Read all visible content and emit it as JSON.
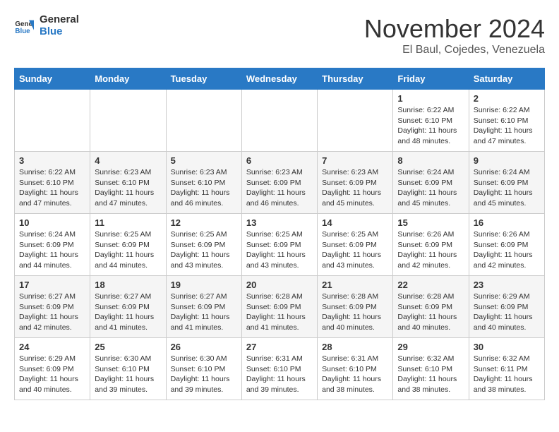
{
  "logo": {
    "line1": "General",
    "line2": "Blue"
  },
  "title": "November 2024",
  "location": "El Baul, Cojedes, Venezuela",
  "weekdays": [
    "Sunday",
    "Monday",
    "Tuesday",
    "Wednesday",
    "Thursday",
    "Friday",
    "Saturday"
  ],
  "weeks": [
    [
      {
        "day": "",
        "sunrise": "",
        "sunset": "",
        "daylight": ""
      },
      {
        "day": "",
        "sunrise": "",
        "sunset": "",
        "daylight": ""
      },
      {
        "day": "",
        "sunrise": "",
        "sunset": "",
        "daylight": ""
      },
      {
        "day": "",
        "sunrise": "",
        "sunset": "",
        "daylight": ""
      },
      {
        "day": "",
        "sunrise": "",
        "sunset": "",
        "daylight": ""
      },
      {
        "day": "1",
        "sunrise": "Sunrise: 6:22 AM",
        "sunset": "Sunset: 6:10 PM",
        "daylight": "Daylight: 11 hours and 48 minutes."
      },
      {
        "day": "2",
        "sunrise": "Sunrise: 6:22 AM",
        "sunset": "Sunset: 6:10 PM",
        "daylight": "Daylight: 11 hours and 47 minutes."
      }
    ],
    [
      {
        "day": "3",
        "sunrise": "Sunrise: 6:22 AM",
        "sunset": "Sunset: 6:10 PM",
        "daylight": "Daylight: 11 hours and 47 minutes."
      },
      {
        "day": "4",
        "sunrise": "Sunrise: 6:23 AM",
        "sunset": "Sunset: 6:10 PM",
        "daylight": "Daylight: 11 hours and 47 minutes."
      },
      {
        "day": "5",
        "sunrise": "Sunrise: 6:23 AM",
        "sunset": "Sunset: 6:10 PM",
        "daylight": "Daylight: 11 hours and 46 minutes."
      },
      {
        "day": "6",
        "sunrise": "Sunrise: 6:23 AM",
        "sunset": "Sunset: 6:09 PM",
        "daylight": "Daylight: 11 hours and 46 minutes."
      },
      {
        "day": "7",
        "sunrise": "Sunrise: 6:23 AM",
        "sunset": "Sunset: 6:09 PM",
        "daylight": "Daylight: 11 hours and 45 minutes."
      },
      {
        "day": "8",
        "sunrise": "Sunrise: 6:24 AM",
        "sunset": "Sunset: 6:09 PM",
        "daylight": "Daylight: 11 hours and 45 minutes."
      },
      {
        "day": "9",
        "sunrise": "Sunrise: 6:24 AM",
        "sunset": "Sunset: 6:09 PM",
        "daylight": "Daylight: 11 hours and 45 minutes."
      }
    ],
    [
      {
        "day": "10",
        "sunrise": "Sunrise: 6:24 AM",
        "sunset": "Sunset: 6:09 PM",
        "daylight": "Daylight: 11 hours and 44 minutes."
      },
      {
        "day": "11",
        "sunrise": "Sunrise: 6:25 AM",
        "sunset": "Sunset: 6:09 PM",
        "daylight": "Daylight: 11 hours and 44 minutes."
      },
      {
        "day": "12",
        "sunrise": "Sunrise: 6:25 AM",
        "sunset": "Sunset: 6:09 PM",
        "daylight": "Daylight: 11 hours and 43 minutes."
      },
      {
        "day": "13",
        "sunrise": "Sunrise: 6:25 AM",
        "sunset": "Sunset: 6:09 PM",
        "daylight": "Daylight: 11 hours and 43 minutes."
      },
      {
        "day": "14",
        "sunrise": "Sunrise: 6:25 AM",
        "sunset": "Sunset: 6:09 PM",
        "daylight": "Daylight: 11 hours and 43 minutes."
      },
      {
        "day": "15",
        "sunrise": "Sunrise: 6:26 AM",
        "sunset": "Sunset: 6:09 PM",
        "daylight": "Daylight: 11 hours and 42 minutes."
      },
      {
        "day": "16",
        "sunrise": "Sunrise: 6:26 AM",
        "sunset": "Sunset: 6:09 PM",
        "daylight": "Daylight: 11 hours and 42 minutes."
      }
    ],
    [
      {
        "day": "17",
        "sunrise": "Sunrise: 6:27 AM",
        "sunset": "Sunset: 6:09 PM",
        "daylight": "Daylight: 11 hours and 42 minutes."
      },
      {
        "day": "18",
        "sunrise": "Sunrise: 6:27 AM",
        "sunset": "Sunset: 6:09 PM",
        "daylight": "Daylight: 11 hours and 41 minutes."
      },
      {
        "day": "19",
        "sunrise": "Sunrise: 6:27 AM",
        "sunset": "Sunset: 6:09 PM",
        "daylight": "Daylight: 11 hours and 41 minutes."
      },
      {
        "day": "20",
        "sunrise": "Sunrise: 6:28 AM",
        "sunset": "Sunset: 6:09 PM",
        "daylight": "Daylight: 11 hours and 41 minutes."
      },
      {
        "day": "21",
        "sunrise": "Sunrise: 6:28 AM",
        "sunset": "Sunset: 6:09 PM",
        "daylight": "Daylight: 11 hours and 40 minutes."
      },
      {
        "day": "22",
        "sunrise": "Sunrise: 6:28 AM",
        "sunset": "Sunset: 6:09 PM",
        "daylight": "Daylight: 11 hours and 40 minutes."
      },
      {
        "day": "23",
        "sunrise": "Sunrise: 6:29 AM",
        "sunset": "Sunset: 6:09 PM",
        "daylight": "Daylight: 11 hours and 40 minutes."
      }
    ],
    [
      {
        "day": "24",
        "sunrise": "Sunrise: 6:29 AM",
        "sunset": "Sunset: 6:09 PM",
        "daylight": "Daylight: 11 hours and 40 minutes."
      },
      {
        "day": "25",
        "sunrise": "Sunrise: 6:30 AM",
        "sunset": "Sunset: 6:10 PM",
        "daylight": "Daylight: 11 hours and 39 minutes."
      },
      {
        "day": "26",
        "sunrise": "Sunrise: 6:30 AM",
        "sunset": "Sunset: 6:10 PM",
        "daylight": "Daylight: 11 hours and 39 minutes."
      },
      {
        "day": "27",
        "sunrise": "Sunrise: 6:31 AM",
        "sunset": "Sunset: 6:10 PM",
        "daylight": "Daylight: 11 hours and 39 minutes."
      },
      {
        "day": "28",
        "sunrise": "Sunrise: 6:31 AM",
        "sunset": "Sunset: 6:10 PM",
        "daylight": "Daylight: 11 hours and 38 minutes."
      },
      {
        "day": "29",
        "sunrise": "Sunrise: 6:32 AM",
        "sunset": "Sunset: 6:10 PM",
        "daylight": "Daylight: 11 hours and 38 minutes."
      },
      {
        "day": "30",
        "sunrise": "Sunrise: 6:32 AM",
        "sunset": "Sunset: 6:11 PM",
        "daylight": "Daylight: 11 hours and 38 minutes."
      }
    ]
  ]
}
